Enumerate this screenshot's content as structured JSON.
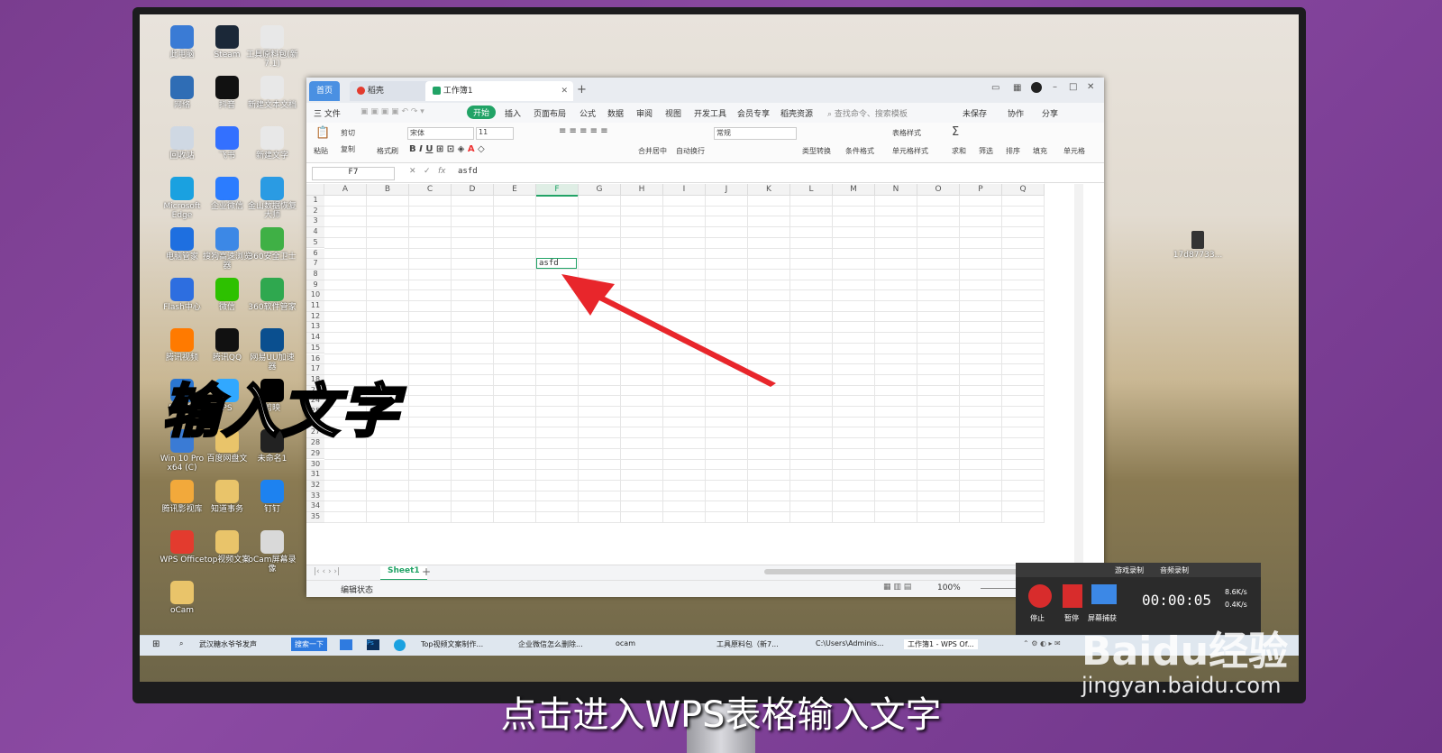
{
  "desktop": {
    "icons": [
      {
        "label": "此电脑",
        "color": "#3a7bd5"
      },
      {
        "label": "Steam",
        "color": "#1b2838"
      },
      {
        "label": "工具原料包(新7.1)",
        "color": "#e8e8e8"
      },
      {
        "label": "网络",
        "color": "#2f6db5"
      },
      {
        "label": "抖音",
        "color": "#111111"
      },
      {
        "label": "新建文本文档",
        "color": "#e8e8e8"
      },
      {
        "label": "回收站",
        "color": "#cfd8e3"
      },
      {
        "label": "飞书",
        "color": "#3370ff"
      },
      {
        "label": "新建文字",
        "color": "#e8e8e8"
      },
      {
        "label": "Microsoft Edge",
        "color": "#1aa1e0"
      },
      {
        "label": "企业微信",
        "color": "#2b7cff"
      },
      {
        "label": "金山数据恢复大师",
        "color": "#2a9be3"
      },
      {
        "label": "电脑管家",
        "color": "#1e6fe0"
      },
      {
        "label": "搜狗高速浏览器",
        "color": "#3c88e6"
      },
      {
        "label": "360安全卫士",
        "color": "#3fb045"
      },
      {
        "label": "Flash中心",
        "color": "#2d6ee0"
      },
      {
        "label": "微信",
        "color": "#2dc100"
      },
      {
        "label": "360软件管家",
        "color": "#2fa84f"
      },
      {
        "label": "腾讯视频",
        "color": "#ff7a00"
      },
      {
        "label": "腾讯QQ",
        "color": "#111111"
      },
      {
        "label": "网易UU加速器",
        "color": "#0a4f8f"
      },
      {
        "label": "EV录屏",
        "color": "#2a76d2"
      },
      {
        "label": "PS",
        "color": "#31a8ff"
      },
      {
        "label": "剪映",
        "color": "#000000"
      },
      {
        "label": "Win 10 Pro x64 (C)",
        "color": "#3a7bd5"
      },
      {
        "label": "百度网盘文",
        "color": "#e9c46a"
      },
      {
        "label": "未命名1",
        "color": "#222222"
      },
      {
        "label": "腾讯影视库",
        "color": "#f2a93b"
      },
      {
        "label": "知道事务",
        "color": "#e9c46a"
      },
      {
        "label": "钉钉",
        "color": "#1d82f0"
      },
      {
        "label": "WPS Office",
        "color": "#e33b2e"
      },
      {
        "label": "top视频文案",
        "color": "#e9c46a"
      },
      {
        "label": "oCam屏幕录像",
        "color": "#d9d9d9"
      },
      {
        "label": "oCam",
        "color": "#e9c46a"
      }
    ],
    "right_icon_label": "17d87733..."
  },
  "window": {
    "tabs": [
      {
        "label": "首页",
        "active": true
      },
      {
        "label": "稻壳",
        "active": false
      },
      {
        "label": "工作簿1",
        "active": false
      }
    ],
    "new_tab": "+",
    "menu": [
      "三 文件",
      "开始",
      "插入",
      "页面布局",
      "公式",
      "数据",
      "审阅",
      "视图",
      "开发工具",
      "会员专享",
      "稻壳资源"
    ],
    "search_placeholder": "查找命令、搜索模板",
    "menu_right": [
      "未保存",
      "协作",
      "分享"
    ],
    "ribbon": {
      "paste": "粘贴",
      "cut": "剪切",
      "copy": "复制",
      "format_painter": "格式刷",
      "font": "宋体",
      "size": "11",
      "merge": "合并居中",
      "wrap": "自动换行",
      "number_format": "常规",
      "type_convert": "类型转换",
      "cond_format": "条件格式",
      "table_style": "表格样式",
      "cell_style": "单元格样式",
      "sum": "求和",
      "filter": "筛选",
      "sort": "排序",
      "fill": "填充",
      "cell": "单元格"
    },
    "namebox": "F7",
    "fx": "fx",
    "formula_value": "asfd",
    "columns": [
      "A",
      "B",
      "C",
      "D",
      "E",
      "F",
      "G",
      "H",
      "I",
      "J",
      "K",
      "L",
      "M",
      "N",
      "O",
      "P",
      "Q"
    ],
    "rows": [
      "1",
      "2",
      "3",
      "4",
      "5",
      "6",
      "7",
      "8",
      "9",
      "10",
      "11",
      "12",
      "13",
      "14",
      "15",
      "16",
      "17",
      "18",
      "23",
      "24",
      "25",
      "26",
      "27",
      "28",
      "29",
      "30",
      "31",
      "32",
      "33",
      "34",
      "35"
    ],
    "active_cell_text": "asfd",
    "sheet": "Sheet1",
    "add_sheet": "+",
    "status": "编辑状态",
    "zoom": "100%"
  },
  "taskbar": {
    "search_text": "武汉糖水爷爷发声",
    "search_btn": "搜索一下",
    "items": [
      "Top视频文案制作...",
      "企业微信怎么删除...",
      "ocam",
      "工具原料包（新7...",
      "C:\\Users\\Adminis...",
      "工作簿1 - WPS Of..."
    ]
  },
  "recorder": {
    "tabs": [
      "游戏录制",
      "音频录制"
    ],
    "buttons": [
      "停止",
      "暂停",
      "屏幕捕获"
    ],
    "time": "00:00:05",
    "rates": [
      "8.6K/s",
      "0.4K/s"
    ]
  },
  "overlay_text": "输入文字",
  "caption": "点击进入WPS表格输入文字",
  "watermark": "Baidu经验",
  "watermark_sub": "jingyan.baidu.com",
  "colors": {
    "accent": "#21a366",
    "arrow": "#e8262b",
    "tab_active": "#4a90e2"
  }
}
